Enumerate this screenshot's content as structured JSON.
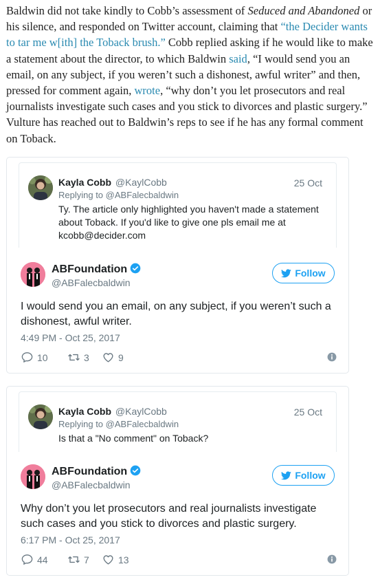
{
  "article": {
    "p1_a": "Baldwin did not take kindly to Cobb’s assessment of ",
    "p1_italic": "Seduced and Abandoned",
    "p1_b": " or his silence, and responded on Twitter account, claiming that ",
    "p1_link1": "“the Decider wants to tar me w[ith] the Toback brush.”",
    "p1_c": " Cobb replied asking if he would like to make a statement about the director, to which Baldwin ",
    "p1_link2": "said",
    "p1_d": ", “I would send you an email, on any subject, if you weren’t such a dishonest, awful writer” and then, pressed for comment again, ",
    "p1_link3": "wrote",
    "p1_e": ", “why don’t you let prosecutors and real journalists investigate such cases and you stick to divorces and plastic surgery.” Vulture has reached out to Baldwin’s reps to see if he has any formal comment on Toback."
  },
  "colors": {
    "link": "#2a8ab1",
    "twitter_blue": "#1da1f2",
    "muted": "#697882",
    "avatar_pink": "#f07e9c"
  },
  "tweets": [
    {
      "quoted": {
        "name": "Kayla Cobb",
        "handle": "@KaylCobb",
        "date": "25 Oct",
        "reply_to": "Replying to @ABFalecbaldwin",
        "text": "Ty. The article only highlighted you haven't made a statement about Toback. If you'd like to give one pls email me at kcobb@decider.com"
      },
      "name": "ABFoundation",
      "handle": "@ABFalecbaldwin",
      "follow_label": "Follow",
      "text": "I would send you an email, on any subject, if you weren’t such a dishonest, awful writer.",
      "timestamp": "4:49 PM - Oct 25, 2017",
      "replies": "10",
      "retweets": "3",
      "likes": "9"
    },
    {
      "quoted": {
        "name": "Kayla Cobb",
        "handle": "@KaylCobb",
        "date": "25 Oct",
        "reply_to": "Replying to @ABFalecbaldwin",
        "text": "Is that a \"No comment\" on Toback?"
      },
      "name": "ABFoundation",
      "handle": "@ABFalecbaldwin",
      "follow_label": "Follow",
      "text": "Why don’t you let prosecutors and real journalists investigate such cases and you stick to divorces and plastic surgery.",
      "timestamp": "6:17 PM - Oct 25, 2017",
      "replies": "44",
      "retweets": "7",
      "likes": "13"
    }
  ],
  "icons": {
    "reply": "reply-icon",
    "retweet": "retweet-icon",
    "like": "heart-icon",
    "info": "info-icon",
    "verified": "verified-badge-icon",
    "follow": "twitter-bird-icon"
  }
}
